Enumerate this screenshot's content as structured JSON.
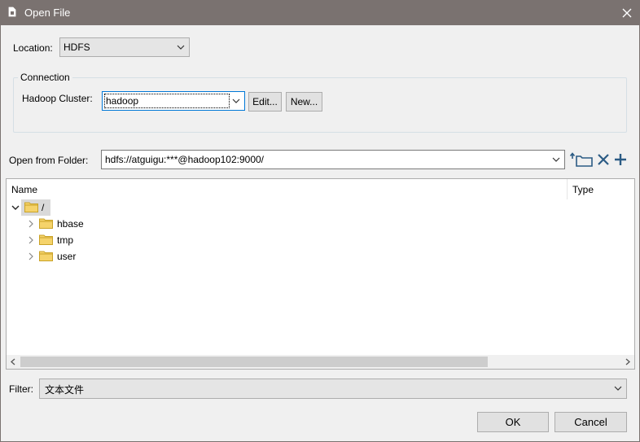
{
  "window": {
    "title": "Open File",
    "icon": "document-icon",
    "close_icon": "close-icon"
  },
  "location": {
    "label": "Location:",
    "value": "HDFS"
  },
  "connection": {
    "legend": "Connection",
    "cluster_label": "Hadoop Cluster:",
    "cluster_value": "hadoop",
    "edit_label": "Edit...",
    "new_label": "New..."
  },
  "folder": {
    "label": "Open from Folder:",
    "value": "hdfs://atguigu:***@hadoop102:9000/",
    "tools": [
      "folder-up-icon",
      "delete-icon",
      "add-icon"
    ]
  },
  "tree": {
    "columns": [
      "Name",
      "Type"
    ],
    "root": {
      "name": "/",
      "expanded": true,
      "selected": true
    },
    "children": [
      {
        "name": "hbase"
      },
      {
        "name": "tmp"
      },
      {
        "name": "user"
      }
    ]
  },
  "filter": {
    "label": "Filter:",
    "value": "文本文件"
  },
  "buttons": {
    "ok": "OK",
    "cancel": "Cancel"
  },
  "colors": {
    "titlebar": "#7a7270",
    "folder": "#f5d36b",
    "tool_icon": "#2b5b84"
  }
}
